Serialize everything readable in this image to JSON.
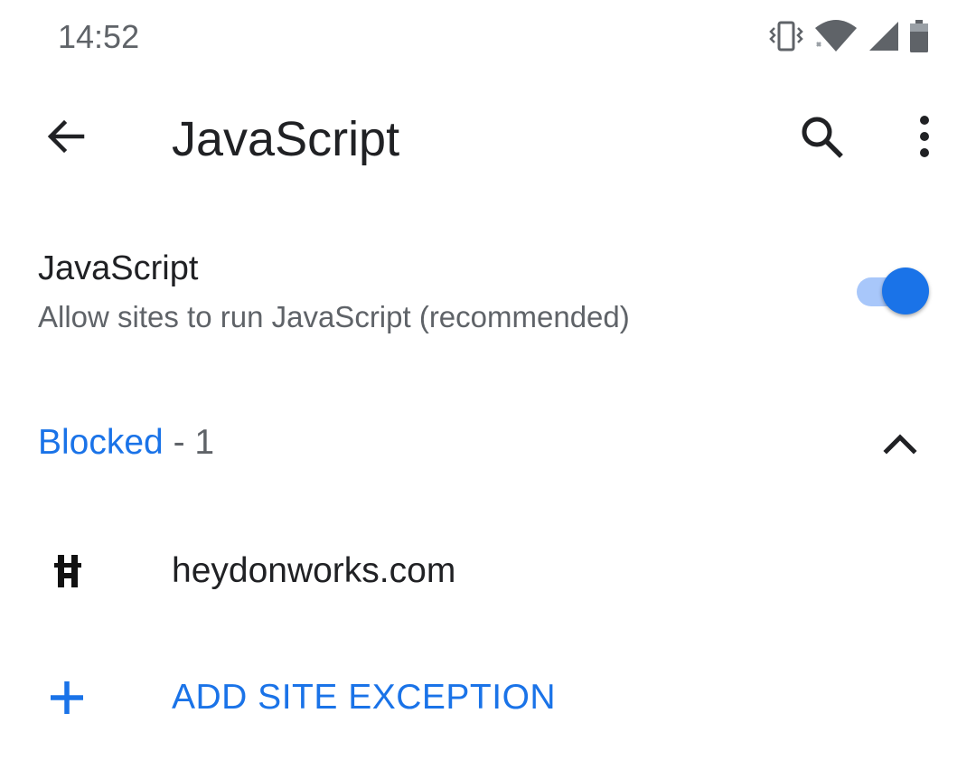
{
  "status_bar": {
    "time": "14:52",
    "icons": [
      "vibrate-icon",
      "wifi-icon",
      "cellular-signal-icon",
      "battery-icon"
    ]
  },
  "app_bar": {
    "title": "JavaScript",
    "back_icon": "arrow-back-icon",
    "search_icon": "search-icon",
    "more_icon": "more-vert-icon"
  },
  "setting": {
    "title": "JavaScript",
    "summary": "Allow sites to run JavaScript (recommended)",
    "enabled": true
  },
  "blocked_section": {
    "label": "Blocked",
    "count_text": " - 1",
    "expanded": true
  },
  "sites": [
    {
      "name": "heydonworks.com",
      "favicon": "heydonworks-favicon"
    }
  ],
  "add_exception": {
    "label": "ADD SITE EXCEPTION",
    "icon": "plus-icon"
  },
  "colors": {
    "accent": "#1a73e8",
    "toggle_track": "#a8c7fa",
    "text_primary": "#202124",
    "text_secondary": "#5f6368"
  }
}
